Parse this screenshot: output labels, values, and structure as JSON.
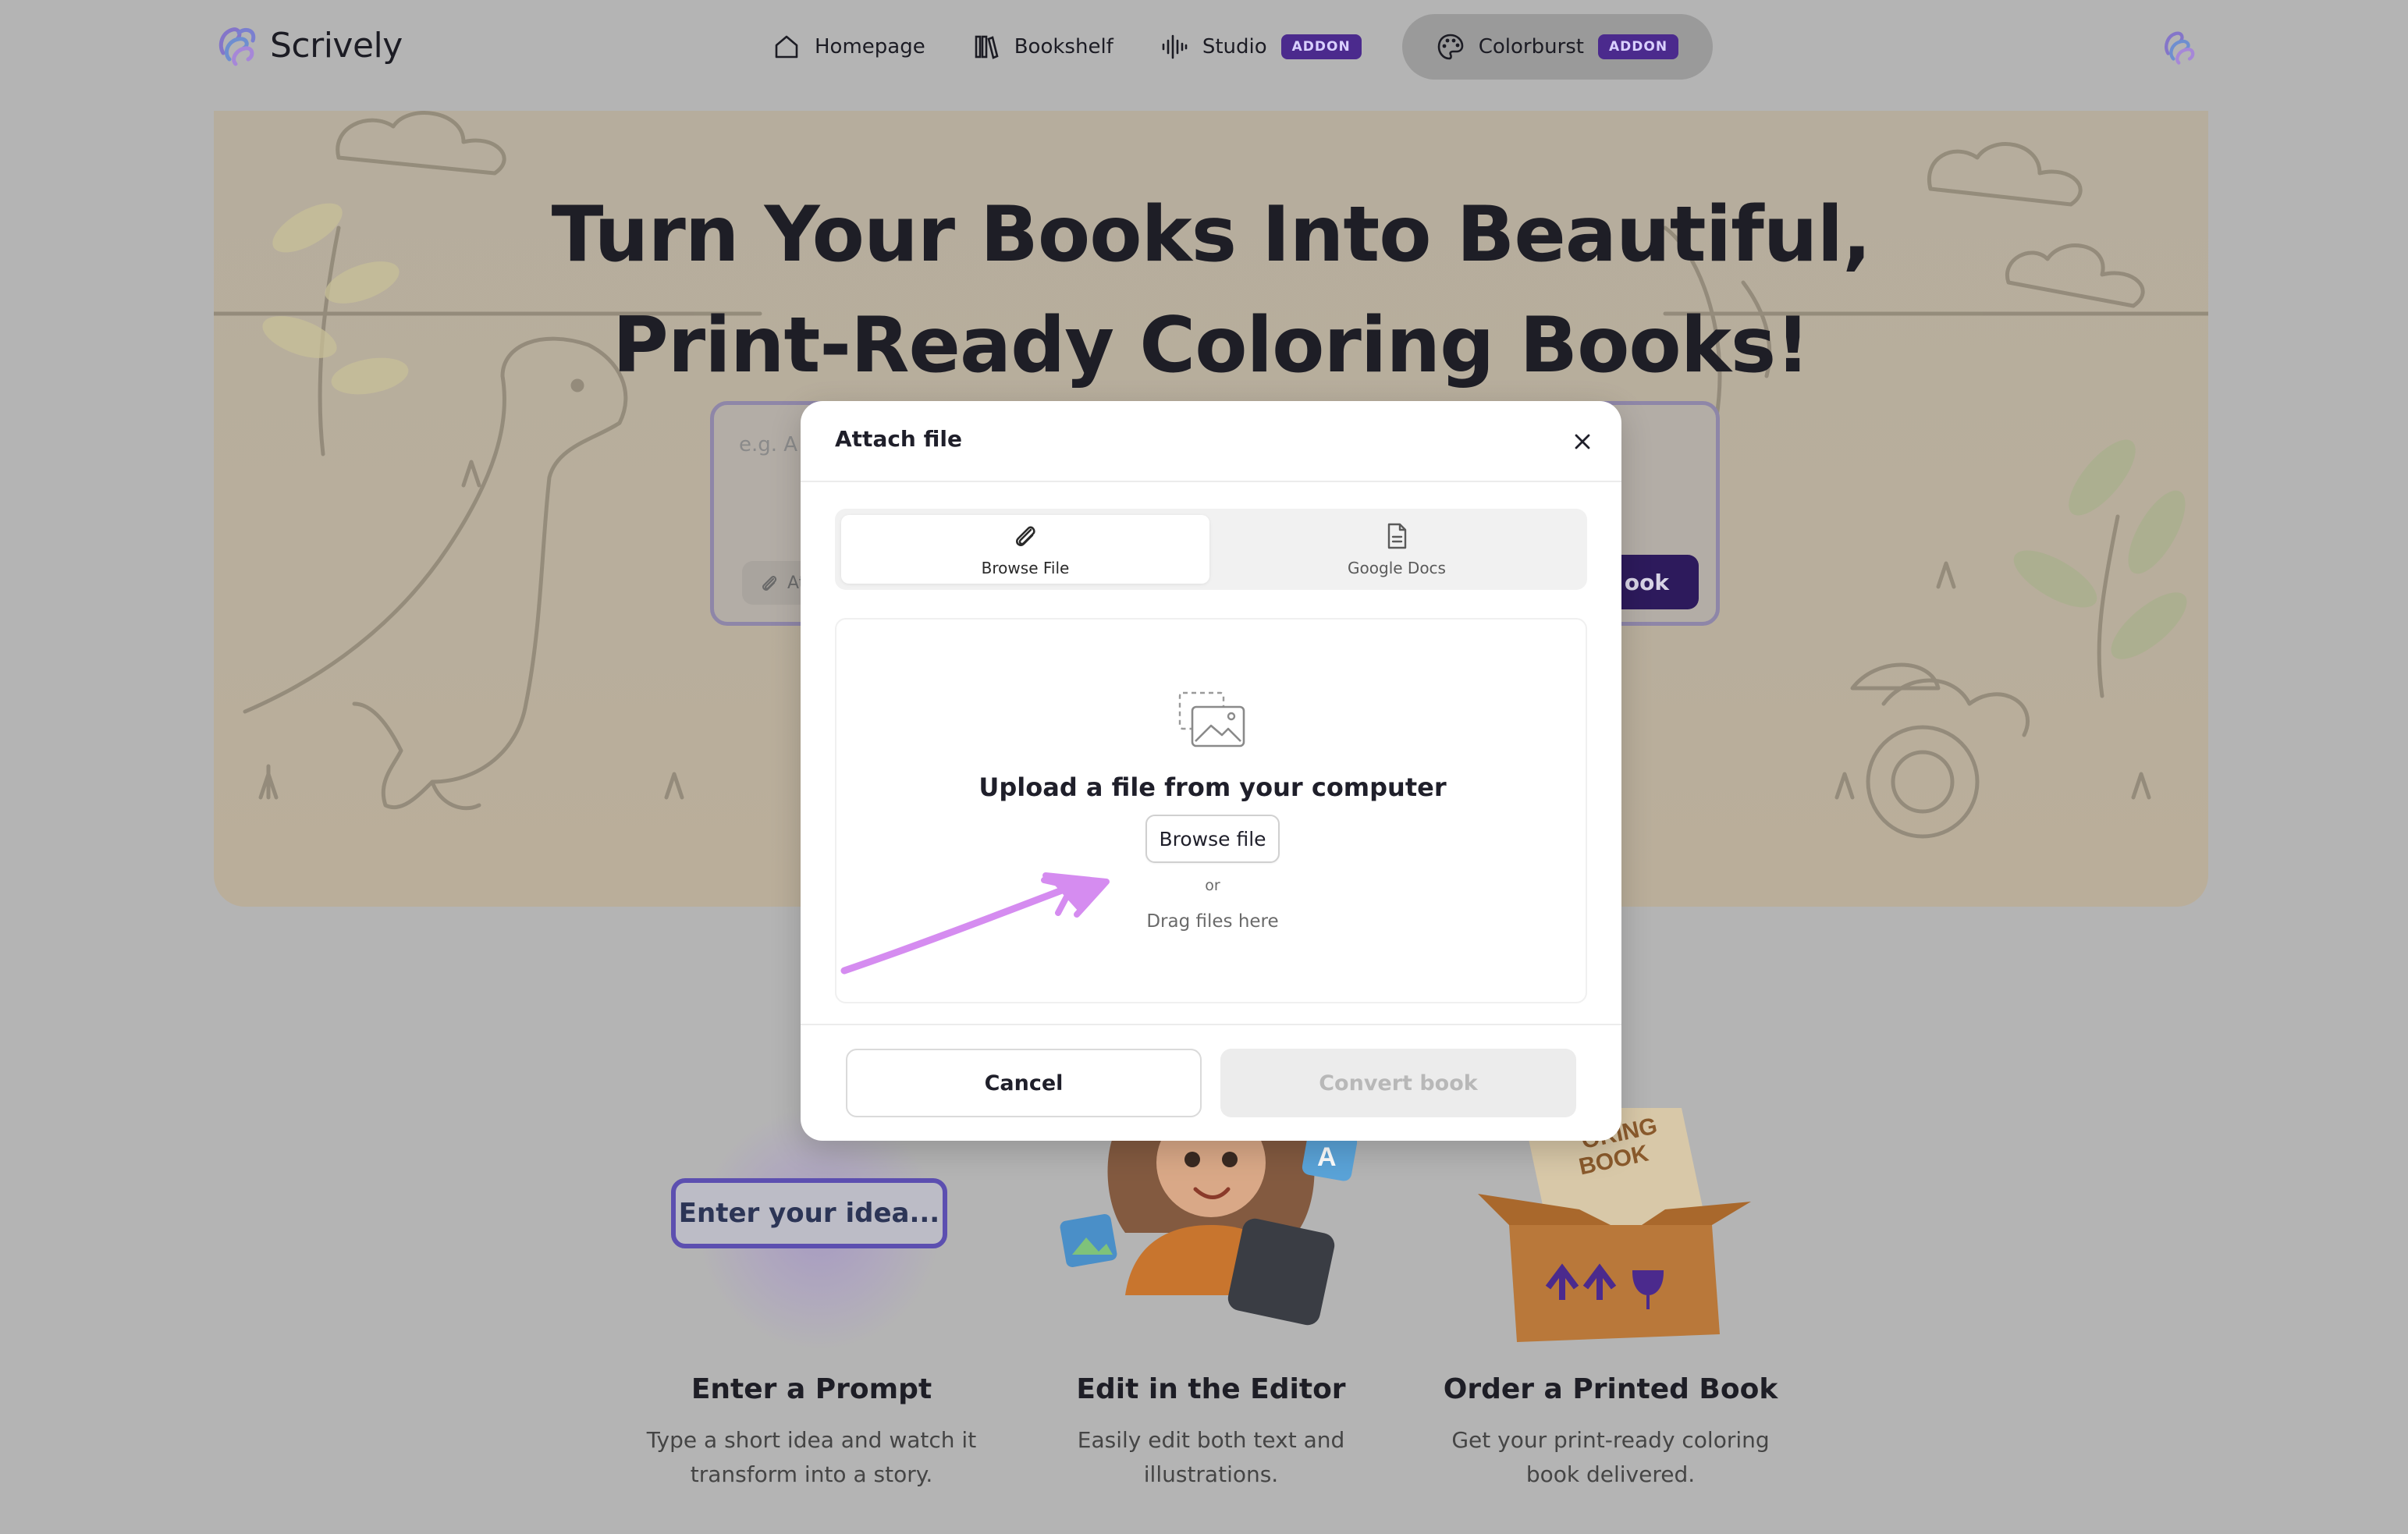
{
  "brand": {
    "name": "Scrively"
  },
  "nav": {
    "items": [
      {
        "label": "Homepage",
        "icon": "home-icon"
      },
      {
        "label": "Bookshelf",
        "icon": "bookshelf-icon"
      },
      {
        "label": "Studio",
        "icon": "audio-waveform-icon",
        "badge": "ADDON"
      },
      {
        "label": "Colorburst",
        "icon": "palette-icon",
        "badge": "ADDON",
        "active": true
      }
    ]
  },
  "hero": {
    "title_line1": "Turn Your Books Into Beautiful,",
    "title_line2": "Print-Ready Coloring Books!",
    "prompt_placeholder": "e.g. A y",
    "attach_label": "At",
    "create_label": "ook"
  },
  "features": [
    {
      "title": "Enter a Prompt",
      "desc_line1": "Type a short idea and watch it",
      "desc_line2": "transform into a story.",
      "pill": "Enter your idea..."
    },
    {
      "title": "Edit in the Editor",
      "desc_line1": "Easily edit both text and",
      "desc_line2": "illustrations."
    },
    {
      "title": "Order a Printed Book",
      "desc_line1": "Get your print-ready coloring",
      "desc_line2": "book delivered.",
      "box_text1": "ORING",
      "box_text2": "BOOK"
    }
  ],
  "modal": {
    "title": "Attach file",
    "tabs": [
      {
        "label": "Browse File",
        "icon": "paperclip-icon",
        "active": true
      },
      {
        "label": "Google Docs",
        "icon": "document-icon",
        "active": false
      }
    ],
    "upload_title": "Upload a file from your computer",
    "browse_button": "Browse file",
    "or": "or",
    "drag_text": "Drag files here",
    "cancel_button": "Cancel",
    "convert_button": "Convert book"
  },
  "colors": {
    "overlay_bg": "#b4b4b4",
    "brand_purple": "#4b2a8d",
    "create_button": "#2d1a5c",
    "annotation_arrow": "#d58cf0"
  }
}
